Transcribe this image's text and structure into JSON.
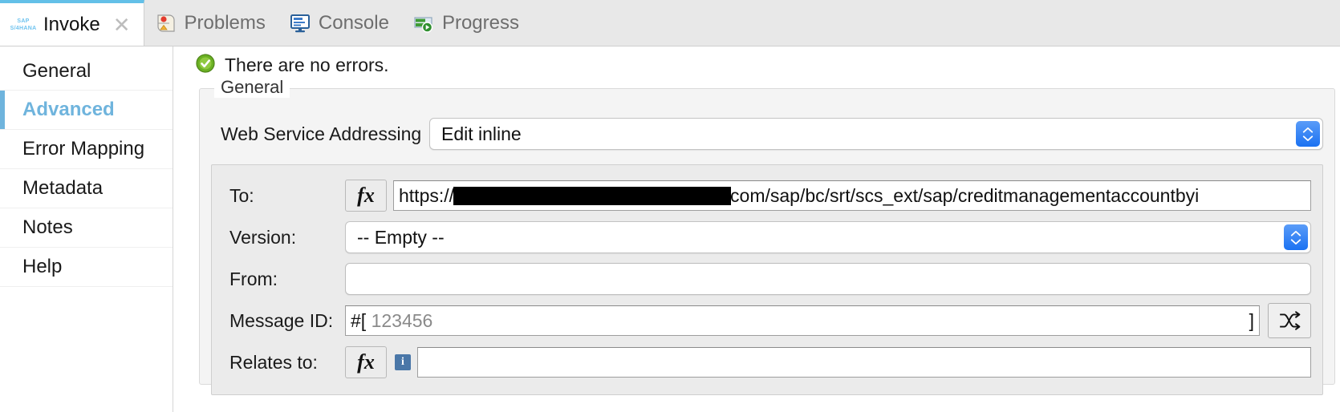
{
  "window": {
    "active_tab": "Invoke",
    "logo_line1": "SAP",
    "logo_line2": "S/4HANA",
    "close_glyph": "✕"
  },
  "tabs": [
    {
      "label": "Invoke",
      "icon": "sap-s4hana-logo-icon",
      "active": true,
      "closable": true
    },
    {
      "label": "Problems",
      "icon": "problems-icon",
      "active": false,
      "closable": false
    },
    {
      "label": "Console",
      "icon": "console-icon",
      "active": false,
      "closable": false
    },
    {
      "label": "Progress",
      "icon": "progress-icon",
      "active": false,
      "closable": false
    }
  ],
  "sidebar": {
    "items": [
      {
        "label": "General",
        "selected": false
      },
      {
        "label": "Advanced",
        "selected": true
      },
      {
        "label": "Error Mapping",
        "selected": false
      },
      {
        "label": "Metadata",
        "selected": false
      },
      {
        "label": "Notes",
        "selected": false
      },
      {
        "label": "Help",
        "selected": false
      }
    ]
  },
  "content": {
    "status_text": "There are no errors.",
    "status_icon": "success-check-icon",
    "group_title": "General",
    "web_service_addressing": {
      "label": "Web Service Addressing",
      "value": "Edit inline"
    },
    "fields": {
      "to": {
        "label": "To:",
        "fx_label": "fx",
        "value_prefix": "https://",
        "value_suffix": "com/sap/bc/srt/scs_ext/sap/creditmanagementaccountbyi",
        "redacted": true
      },
      "version": {
        "label": "Version:",
        "value": "-- Empty --"
      },
      "from": {
        "label": "From:",
        "value": ""
      },
      "message_id": {
        "label": "Message ID:",
        "open_token": "#[",
        "value": "123456",
        "close_token": "]",
        "button_icon": "shuffle-icon"
      },
      "relates_to": {
        "label": "Relates to:",
        "fx_label": "fx",
        "info_glyph": "i",
        "value": ""
      }
    }
  },
  "colors": {
    "accent_blue": "#6fb4dd",
    "tab_top_border": "#63c0e8",
    "stepper_blue": "#1b72f2",
    "success_green": "#6ab023",
    "sap_logo_blue": "#6fc3ef"
  }
}
